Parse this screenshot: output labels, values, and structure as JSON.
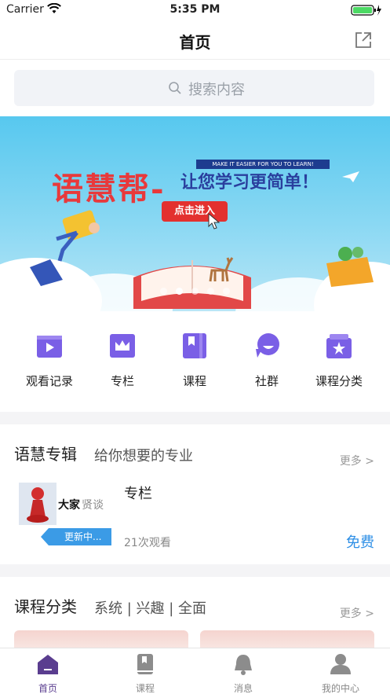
{
  "status_bar": {
    "carrier": "Carrier",
    "time": "5:35 PM"
  },
  "nav": {
    "title": "首页"
  },
  "search": {
    "placeholder": "搜索内容"
  },
  "banner": {
    "brand": "语慧帮-",
    "slogan": "让您学习更简单！",
    "tagline": "MAKE IT EASIER FOR YOU TO LEARN!",
    "cta": "点击进入",
    "page_count": 5,
    "active_page": 1
  },
  "quick_links": [
    {
      "label": "观看记录",
      "icon": "play-video-icon"
    },
    {
      "label": "专栏",
      "icon": "crown-icon"
    },
    {
      "label": "课程",
      "icon": "bookmark-book-icon"
    },
    {
      "label": "社群",
      "icon": "chat-bubble-icon"
    },
    {
      "label": "课程分类",
      "icon": "star-folder-icon"
    }
  ],
  "section_featured": {
    "title": "语慧专辑",
    "subtitle": "给你想要的专业",
    "more": "更多 >",
    "card": {
      "thumb_caption_bold": "大家",
      "thumb_caption_light": "贤谈",
      "tag": "更新中...",
      "title": "专栏",
      "views": "21次观看",
      "price": "免费"
    }
  },
  "section_categories": {
    "title": "课程分类",
    "subtitle": "系统 | 兴趣 | 全面",
    "more": "更多 >"
  },
  "tabbar": [
    {
      "label": "首页",
      "icon": "home-icon",
      "active": true
    },
    {
      "label": "课程",
      "icon": "course-book-icon",
      "active": false
    },
    {
      "label": "消息",
      "icon": "bell-icon",
      "active": false
    },
    {
      "label": "我的中心",
      "icon": "user-icon",
      "active": false
    }
  ],
  "colors": {
    "accent": "#7a5fe6",
    "active_tab": "#5a3d8f",
    "price": "#2e8fe6",
    "banner_red": "#e3312f"
  }
}
